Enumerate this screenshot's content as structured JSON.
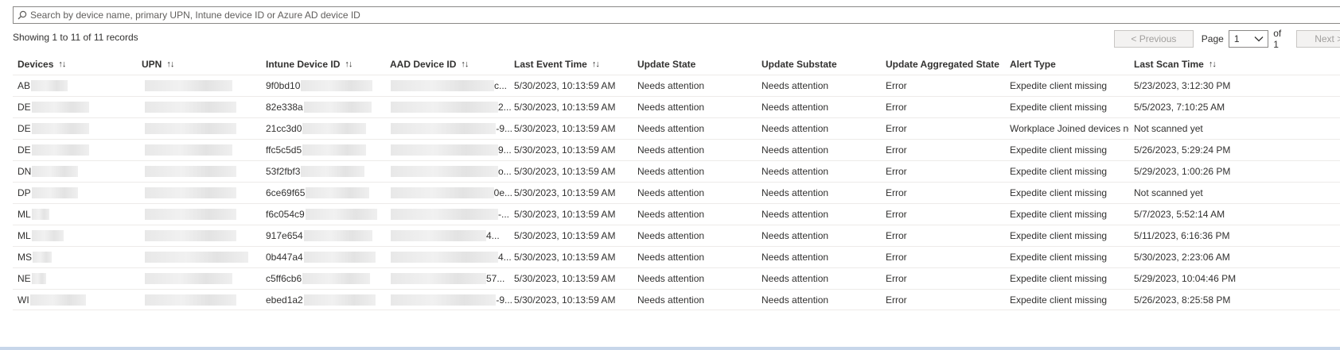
{
  "search": {
    "placeholder": "Search by device name, primary UPN, Intune device ID or Azure AD device ID",
    "icon": "search-icon"
  },
  "summary": "Showing 1 to 11 of 11 records",
  "pagination": {
    "previous_label": "< Previous",
    "page_label": "Page",
    "current_page": "1",
    "of_label": "of 1",
    "next_label": "Next >"
  },
  "columns": [
    {
      "label": "Devices",
      "sortable": true
    },
    {
      "label": "UPN",
      "sortable": true
    },
    {
      "label": "Intune Device ID",
      "sortable": true
    },
    {
      "label": "AAD Device ID",
      "sortable": true
    },
    {
      "label": "Last Event Time",
      "sortable": true
    },
    {
      "label": "Update State",
      "sortable": false
    },
    {
      "label": "Update Substate",
      "sortable": false
    },
    {
      "label": "Update Aggregated State",
      "sortable": false
    },
    {
      "label": "Alert Type",
      "sortable": false
    },
    {
      "label": "Last Scan Time",
      "sortable": true
    }
  ],
  "rows": [
    {
      "device": "AB",
      "upn": "",
      "intune_id": "9f0bd10",
      "aad_id": "c...",
      "last_event": "5/30/2023, 10:13:59 AM",
      "state": "Needs attention",
      "substate": "Needs attention",
      "aggregated": "Error",
      "alert": "Expedite client missing",
      "last_scan": "5/23/2023, 3:12:30 PM"
    },
    {
      "device": "DE",
      "upn": "",
      "intune_id": "82e338a",
      "aad_id": "2...",
      "last_event": "5/30/2023, 10:13:59 AM",
      "state": "Needs attention",
      "substate": "Needs attention",
      "aggregated": "Error",
      "alert": "Expedite client missing",
      "last_scan": "5/5/2023, 7:10:25 AM"
    },
    {
      "device": "DE",
      "upn": "",
      "intune_id": "21cc3d0",
      "aad_id": "-9...",
      "last_event": "5/30/2023, 10:13:59 AM",
      "state": "Needs attention",
      "substate": "Needs attention",
      "aggregated": "Error",
      "alert": "Workplace Joined devices no...",
      "last_scan": "Not scanned yet"
    },
    {
      "device": "DE",
      "upn": "",
      "intune_id": "ffc5c5d5",
      "aad_id": "9...",
      "last_event": "5/30/2023, 10:13:59 AM",
      "state": "Needs attention",
      "substate": "Needs attention",
      "aggregated": "Error",
      "alert": "Expedite client missing",
      "last_scan": "5/26/2023, 5:29:24 PM"
    },
    {
      "device": "DN",
      "upn": "",
      "intune_id": "53f2fbf3",
      "aad_id": "o...",
      "last_event": "5/30/2023, 10:13:59 AM",
      "state": "Needs attention",
      "substate": "Needs attention",
      "aggregated": "Error",
      "alert": "Expedite client missing",
      "last_scan": "5/29/2023, 1:00:26 PM"
    },
    {
      "device": "DP",
      "upn": "",
      "intune_id": "6ce69f65",
      "aad_id": "0e...",
      "last_event": "5/30/2023, 10:13:59 AM",
      "state": "Needs attention",
      "substate": "Needs attention",
      "aggregated": "Error",
      "alert": "Expedite client missing",
      "last_scan": "Not scanned yet"
    },
    {
      "device": "ML",
      "upn": "",
      "intune_id": "f6c054c9",
      "aad_id": "-...",
      "last_event": "5/30/2023, 10:13:59 AM",
      "state": "Needs attention",
      "substate": "Needs attention",
      "aggregated": "Error",
      "alert": "Expedite client missing",
      "last_scan": "5/7/2023, 5:52:14 AM"
    },
    {
      "device": "ML",
      "upn": "",
      "intune_id": "917e654",
      "aad_id": "4...",
      "last_event": "5/30/2023, 10:13:59 AM",
      "state": "Needs attention",
      "substate": "Needs attention",
      "aggregated": "Error",
      "alert": "Expedite client missing",
      "last_scan": "5/11/2023, 6:16:36 PM"
    },
    {
      "device": "MS",
      "upn": "",
      "intune_id": "0b447a4",
      "aad_id": "4...",
      "last_event": "5/30/2023, 10:13:59 AM",
      "state": "Needs attention",
      "substate": "Needs attention",
      "aggregated": "Error",
      "alert": "Expedite client missing",
      "last_scan": "5/30/2023, 2:23:06 AM"
    },
    {
      "device": "NE",
      "upn": "",
      "intune_id": "c5ff6cb6",
      "aad_id": "57...",
      "last_event": "5/30/2023, 10:13:59 AM",
      "state": "Needs attention",
      "substate": "Needs attention",
      "aggregated": "Error",
      "alert": "Expedite client missing",
      "last_scan": "5/29/2023, 10:04:46 PM"
    },
    {
      "device": "WI",
      "upn": "",
      "intune_id": "ebed1a2",
      "aad_id": "-9...",
      "last_event": "5/30/2023, 10:13:59 AM",
      "state": "Needs attention",
      "substate": "Needs attention",
      "aggregated": "Error",
      "alert": "Expedite client missing",
      "last_scan": "5/26/2023, 8:25:58 PM"
    }
  ]
}
